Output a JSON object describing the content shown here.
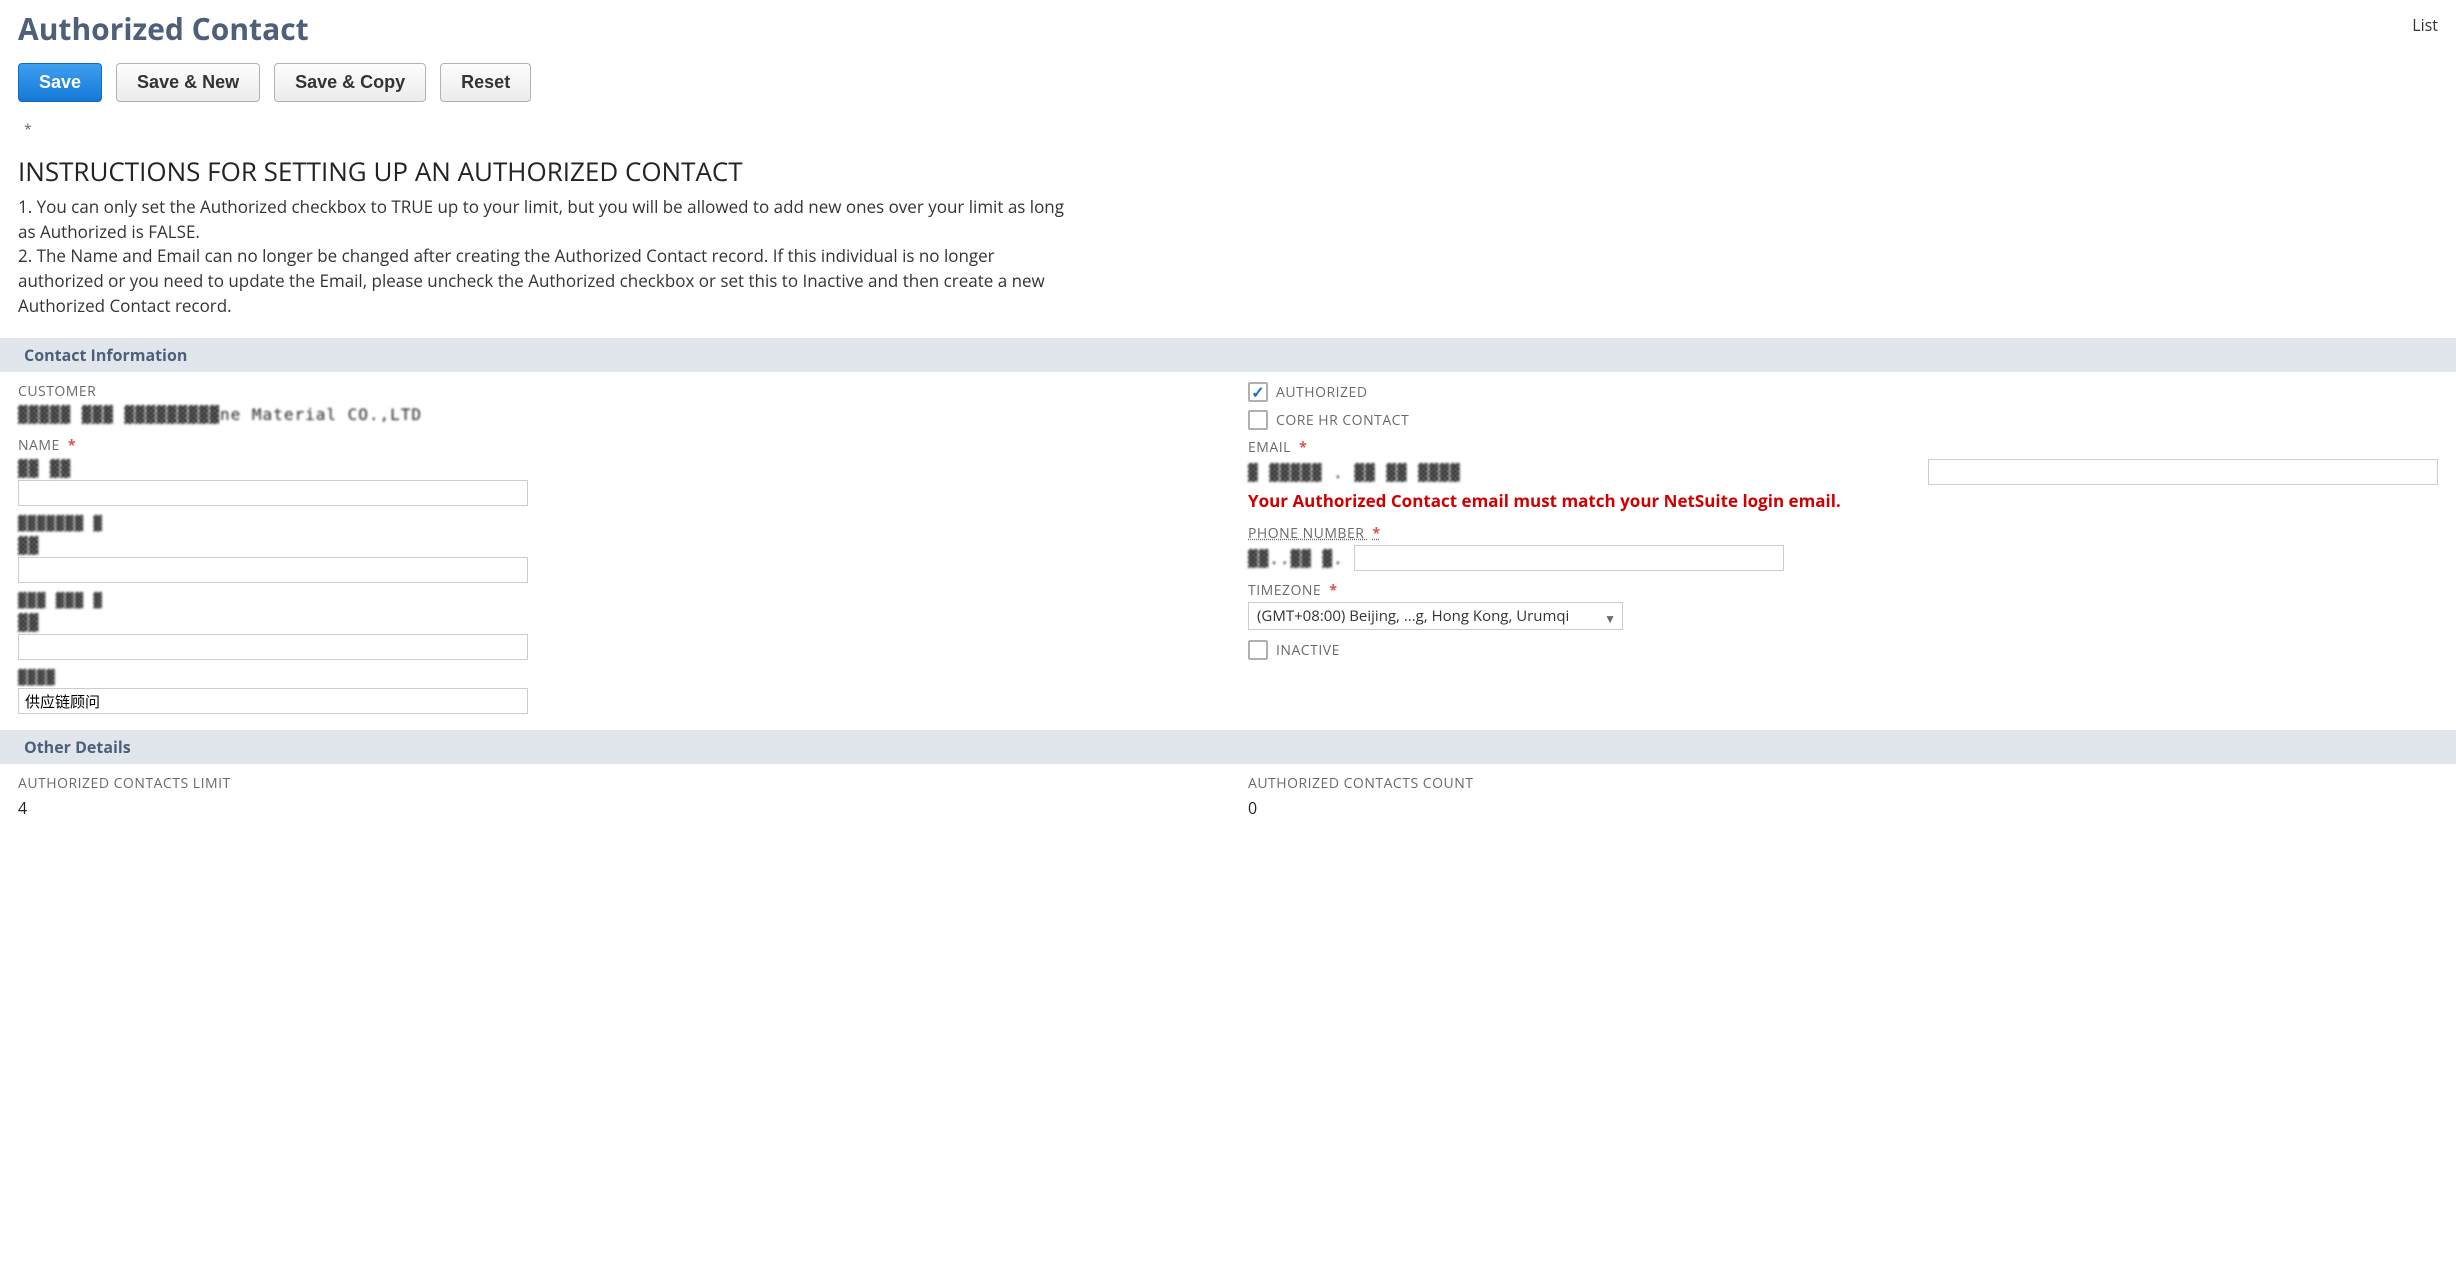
{
  "header": {
    "title": "Authorized Contact",
    "list_link": "List"
  },
  "buttons": {
    "save": "Save",
    "save_new": "Save & New",
    "save_copy": "Save & Copy",
    "reset": "Reset"
  },
  "required_marker": "*",
  "instructions": {
    "heading": "INSTRUCTIONS FOR SETTING UP AN AUTHORIZED CONTACT",
    "line1": "1. You can only set the Authorized checkbox to TRUE up to your limit, but you will be allowed to add new ones over your limit as long as Authorized is FALSE.",
    "line2": "2. The Name and Email can no longer be changed after creating the Authorized Contact record. If this individual is no longer authorized or you need to update the Email, please uncheck the Authorized checkbox or set this to Inactive and then create a new Authorized Contact record."
  },
  "sections": {
    "contact_info": "Contact Information",
    "other_details": "Other Details"
  },
  "left": {
    "customer_label": "CUSTOMER",
    "customer_value": "▓▓▓▓▓ ▓▓▓ ▓▓▓▓▓▓▓▓▓ne Material CO.,LTD",
    "name_label": "NAME",
    "name_value": "▓▓ ▓▓",
    "name_input": "",
    "n2_label": "▓▓▓▓▓▓▓ ▓",
    "n2_value": "▓▓",
    "n2_input": "",
    "n3_label": "▓▓▓ ▓▓▓ ▓",
    "n3_value": "▓▓",
    "n3_input": "",
    "n4_label": "▓▓▓▓",
    "n4_input": "供应链顾问"
  },
  "right": {
    "authorized_label": "AUTHORIZED",
    "authorized_checked": true,
    "corehr_label": "CORE HR CONTACT",
    "corehr_checked": false,
    "email_label": "EMAIL",
    "email_value": "▓ ▓▓▓▓▓ . ▓▓ ▓▓ ▓▓▓▓",
    "email_small_input": "",
    "email_warning": "Your Authorized Contact email must match your NetSuite login email.",
    "phone_label": "PHONE NUMBER",
    "phone_value": "▓▓..▓▓ ▓.",
    "phone_input": "",
    "timezone_label": "TIMEZONE",
    "timezone_value": "(GMT+08:00) Beijing, ...g, Hong Kong, Urumqi",
    "inactive_label": "INACTIVE",
    "inactive_checked": false
  },
  "other": {
    "limit_label": "AUTHORIZED CONTACTS LIMIT",
    "limit_value": "4",
    "count_label": "AUTHORIZED CONTACTS COUNT",
    "count_value": "0"
  }
}
